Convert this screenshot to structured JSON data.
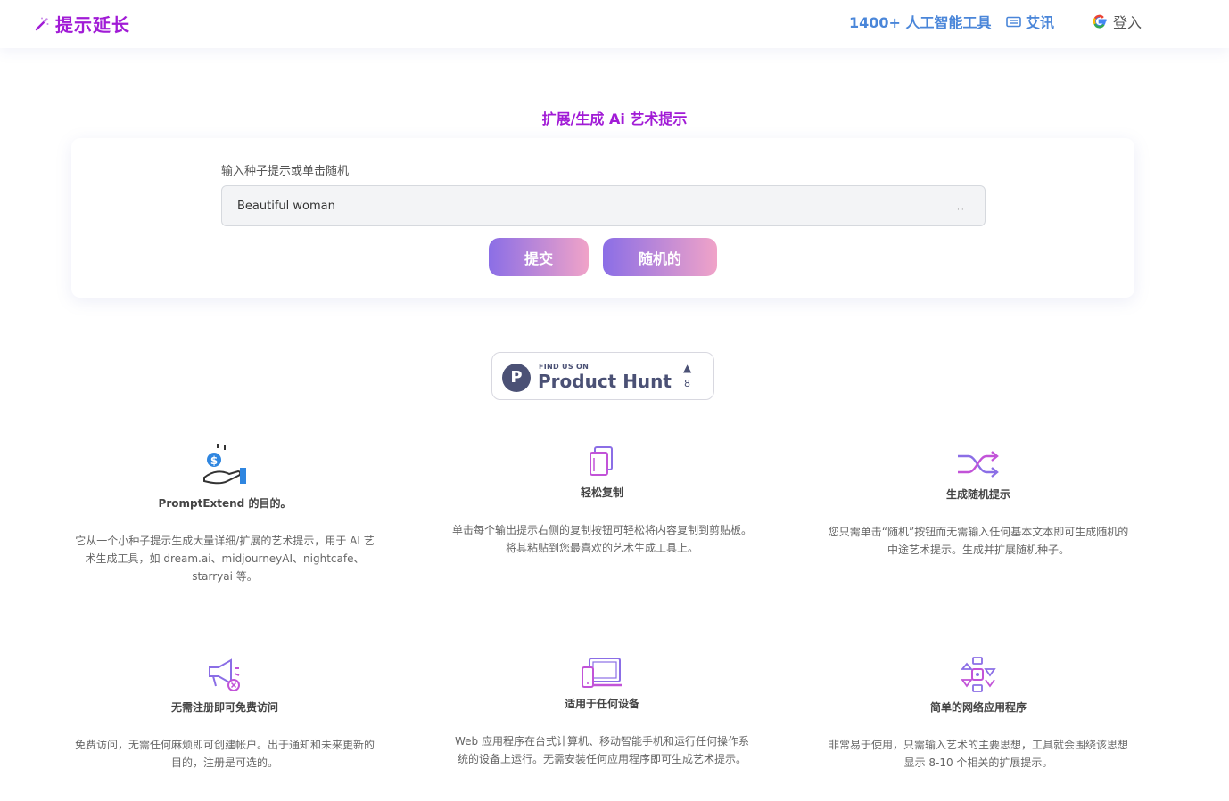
{
  "header": {
    "logo_text": "提示延长",
    "nav_tools": "1400+ 人工智能工具",
    "nav_news": "艾讯",
    "nav_login": "登入"
  },
  "main": {
    "title": "扩展/生成 Ai 艺术提示",
    "seed_label": "输入种子提示或单击随机",
    "seed_value": "Beautiful woman",
    "submit_label": "提交",
    "random_label": "随机的"
  },
  "product_hunt": {
    "find_us": "FIND US ON",
    "name": "Product Hunt",
    "logo_letter": "P",
    "arrow": "▲",
    "count": "8"
  },
  "features": [
    {
      "icon": "money-hand-icon",
      "title": "PromptExtend 的目的。",
      "desc": "它从一个小种子提示生成大量详细/扩展的艺术提示，用于 AI 艺术生成工具，如 dream.ai、midjourneyAI、nightcafe、starryai 等。"
    },
    {
      "icon": "copy-icon",
      "title": "轻松复制",
      "desc": "单击每个输出提示右侧的复制按钮可轻松将内容复制到剪贴板。将其粘贴到您最喜欢的艺术生成工具上。"
    },
    {
      "icon": "shuffle-icon",
      "title": "生成随机提示",
      "desc": "您只需单击“随机”按钮而无需输入任何基本文本即可生成随机的中途艺术提示。生成并扩展随机种子。"
    },
    {
      "icon": "megaphone-icon",
      "title": "无需注册即可免费访问",
      "desc": "免费访问，无需任何麻烦即可创建帐户。出于通知和未来更新的目的，注册是可选的。"
    },
    {
      "icon": "devices-icon",
      "title": "适用于任何设备",
      "desc": "Web 应用程序在台式计算机、移动智能手机和运行任何操作系统的设备上运行。无需安装任何应用程序即可生成艺术提示。"
    },
    {
      "icon": "app-flow-icon",
      "title": "简单的网络应用程序",
      "desc": "非常易于使用，只需输入艺术的主要思想，工具就会围绕该思想显示 8-10 个相关的扩展提示。"
    }
  ],
  "colors": {
    "brand_purple": "#a11bd6",
    "nav_blue": "#4a86d9",
    "button_gradient_start": "#8b6ee6",
    "button_gradient_end": "#f0a3c8"
  }
}
